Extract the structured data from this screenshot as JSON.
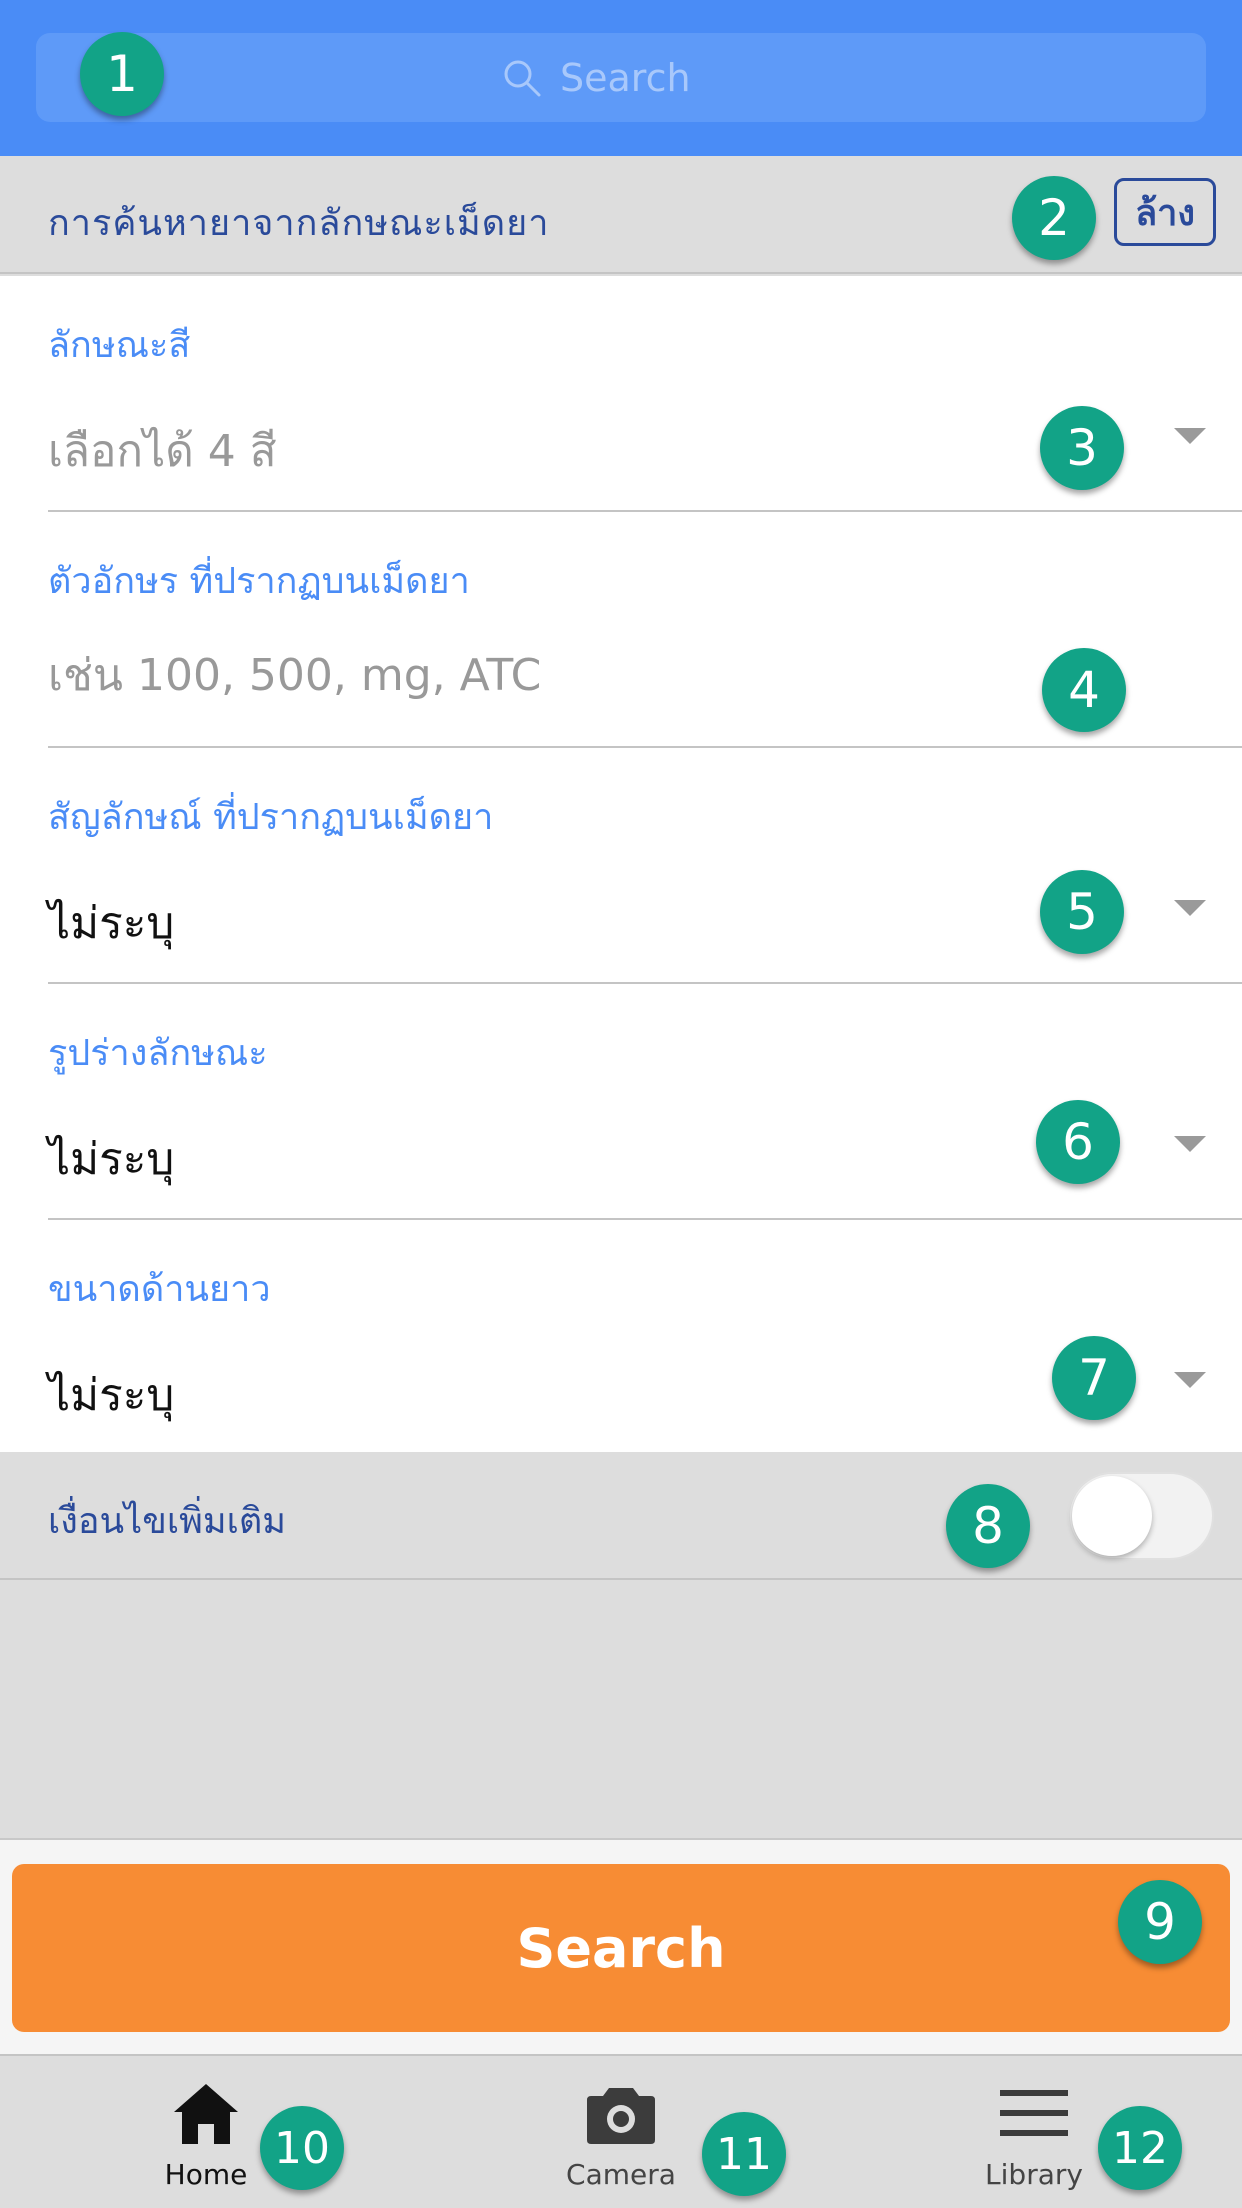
{
  "search": {
    "placeholder": "Search"
  },
  "header": {
    "title": "การค้นหายาจากลักษณะเม็ดยา",
    "clear_label": "ล้าง"
  },
  "fields": [
    {
      "label": "ลักษณะสี",
      "value": "เลือกได้ 4 สี",
      "type": "select",
      "is_placeholder": true
    },
    {
      "label": "ตัวอักษร ที่ปรากฏบนเม็ดยา",
      "placeholder": "เช่น 100, 500, mg, ATC",
      "type": "text"
    },
    {
      "label": "สัญลักษณ์ ที่ปรากฏบนเม็ดยา",
      "value": "ไม่ระบุ",
      "type": "select"
    },
    {
      "label": "รูปร่างลักษณะ",
      "value": "ไม่ระบุ",
      "type": "select"
    },
    {
      "label": "ขนาดด้านยาว",
      "value": "ไม่ระบุ",
      "type": "select"
    }
  ],
  "extra_conditions": {
    "label": "เงื่อนไขเพิ่มเติม",
    "enabled": false
  },
  "search_button": {
    "label": "Search"
  },
  "tabs": [
    {
      "label": "Home",
      "icon": "home-icon",
      "active": true
    },
    {
      "label": "Camera",
      "icon": "camera-icon",
      "active": false
    },
    {
      "label": "Library",
      "icon": "menu-icon",
      "active": false
    }
  ],
  "markers": [
    "1",
    "2",
    "3",
    "4",
    "5",
    "6",
    "7",
    "8",
    "9",
    "10",
    "11",
    "12"
  ],
  "colors": {
    "header_blue": "#4a8cf6",
    "label_blue": "#4a8cf6",
    "title_navy": "#2a4a9a",
    "search_orange": "#f78c34",
    "marker_green": "#12a387"
  }
}
